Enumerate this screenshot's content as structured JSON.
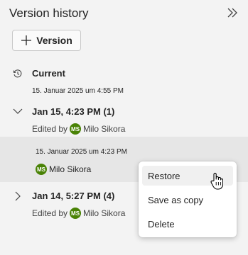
{
  "panel": {
    "title": "Version history",
    "version_button_label": "Version"
  },
  "current": {
    "label": "Current",
    "date": "15. Januar 2025 um 4:55 PM"
  },
  "groups": [
    {
      "label": "Jan 15, 4:23 PM (1)",
      "edited_prefix": "Edited by",
      "author_initials": "MS",
      "author": "Milo Sikora",
      "expanded": true,
      "entries": [
        {
          "date": "15. Januar 2025 um 4:23 PM",
          "author_initials": "MS",
          "author": "Milo Sikora"
        }
      ]
    },
    {
      "label": "Jan 14, 5:27 PM (4)",
      "edited_prefix": "Edited by",
      "author_initials": "MS",
      "author": "Milo Sikora",
      "expanded": false
    }
  ],
  "context_menu": {
    "items": [
      "Restore",
      "Save as copy",
      "Delete"
    ],
    "hovered": "Restore"
  },
  "colors": {
    "avatar": "#498205",
    "panel_bg": "#f3f3f3",
    "selected_bg": "#e6e6e6"
  },
  "icons": {
    "collapse": "double-chevron-right-icon",
    "add": "plus-icon",
    "current": "history-icon",
    "expanded": "chevron-down-icon",
    "collapsed": "chevron-right-icon",
    "pointer": "hand-cursor-icon"
  }
}
